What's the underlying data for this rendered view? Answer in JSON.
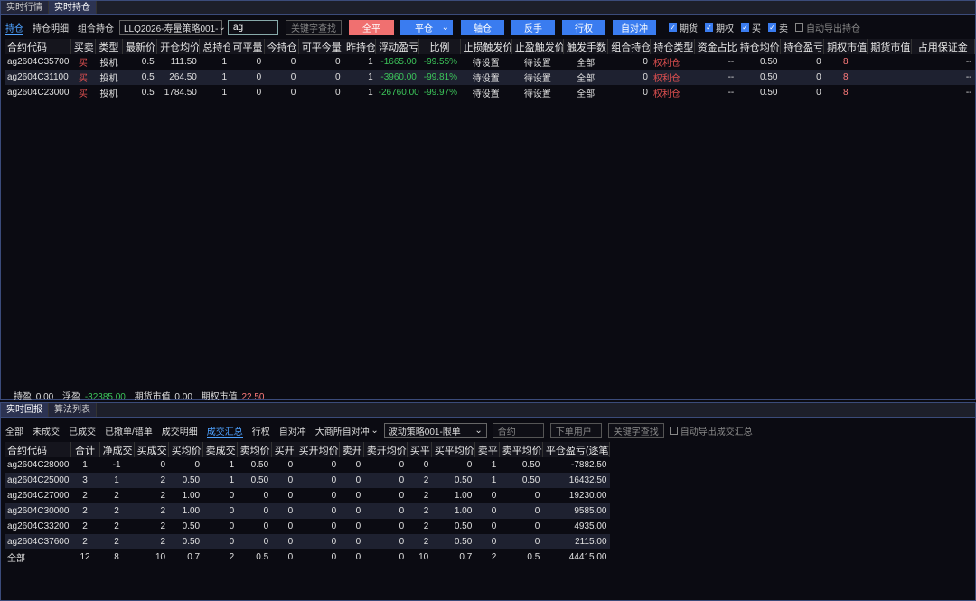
{
  "top": {
    "tabs": [
      "实时行情",
      "实时持仓"
    ],
    "subtabs": [
      "持仓",
      "持仓明细",
      "组合持仓"
    ],
    "strategy_select": "LLQ2026-寿量策略001-",
    "search_value": "ag",
    "keyword_placeholder": "关键字查找",
    "buttons": [
      "全平",
      "平仓",
      "轴仓",
      "反手",
      "行权",
      "自对冲"
    ],
    "checks": [
      {
        "label": "期货",
        "checked": true
      },
      {
        "label": "期权",
        "checked": true
      },
      {
        "label": "买",
        "checked": true
      },
      {
        "label": "卖",
        "checked": true
      },
      {
        "label": "自动导出持仓",
        "checked": false
      }
    ],
    "columns": [
      "合约代码",
      "买卖",
      "类型",
      "最新价",
      "开仓均价",
      "总持仓",
      "可平量",
      "今持仓",
      "可平今量",
      "昨持仓",
      "浮动盈亏",
      "比例",
      "止损触发价",
      "止盈触发价",
      "触发手数",
      "组合持仓",
      "持仓类型",
      "资金占比",
      "持仓均价",
      "持仓盈亏",
      "期权市值",
      "期货市值",
      "占用保证金"
    ],
    "rows": [
      [
        "ag2604C35700",
        "买",
        "投机",
        "0.5",
        "111.50",
        "1",
        "0",
        "0",
        "0",
        "1",
        "-1665.00",
        "-99.55%",
        "待设置",
        "待设置",
        "全部",
        "0",
        "权利仓",
        "--",
        "0.50",
        "0",
        "8",
        "",
        "--"
      ],
      [
        "ag2604C31100",
        "买",
        "投机",
        "0.5",
        "264.50",
        "1",
        "0",
        "0",
        "0",
        "1",
        "-3960.00",
        "-99.81%",
        "待设置",
        "待设置",
        "全部",
        "0",
        "权利仓",
        "--",
        "0.50",
        "0",
        "8",
        "",
        "--"
      ],
      [
        "ag2604C23000",
        "买",
        "投机",
        "0.5",
        "1784.50",
        "1",
        "0",
        "0",
        "0",
        "1",
        "-26760.00",
        "-99.97%",
        "待设置",
        "待设置",
        "全部",
        "0",
        "权利仓",
        "--",
        "0.50",
        "0",
        "8",
        "",
        "--"
      ]
    ],
    "summary": {
      "hold_profit_label": "持盈",
      "hold_profit": "0.00",
      "float_label": "浮盈",
      "float": "-32385.00",
      "fut_label": "期货市值",
      "fut": "0.00",
      "opt_label": "期权市值",
      "opt": "22.50"
    }
  },
  "bottom": {
    "tabs": [
      "实时回报",
      "算法列表"
    ],
    "subtabs": [
      "全部",
      "未成交",
      "已成交",
      "已撤单/错单",
      "成交明细",
      "成交汇总",
      "行权",
      "自对冲"
    ],
    "dealer_select": "大商所自对冲",
    "strategy_select": "波动策略001-限单",
    "contract_placeholder": "合约",
    "user_placeholder": "下单用户",
    "keyword_placeholder": "关键字查找",
    "auto_export": "自动导出成交汇总",
    "columns": [
      "合约代码",
      "合计",
      "净成交",
      "买成交",
      "买均价",
      "卖成交",
      "卖均价",
      "买开",
      "买开均价",
      "卖开",
      "卖开均价",
      "买平",
      "买平均价",
      "卖平",
      "卖平均价",
      "平仓盈亏(逐笔)"
    ],
    "rows": [
      [
        "ag2604C28000",
        "1",
        "-1",
        "0",
        "0",
        "1",
        "0.50",
        "0",
        "0",
        "0",
        "0",
        "0",
        "0",
        "1",
        "0.50",
        "-7882.50"
      ],
      [
        "ag2604C25000",
        "3",
        "1",
        "2",
        "0.50",
        "1",
        "0.50",
        "0",
        "0",
        "0",
        "0",
        "2",
        "0.50",
        "1",
        "0.50",
        "16432.50"
      ],
      [
        "ag2604C27000",
        "2",
        "2",
        "2",
        "1.00",
        "0",
        "0",
        "0",
        "0",
        "0",
        "0",
        "2",
        "1.00",
        "0",
        "0",
        "19230.00"
      ],
      [
        "ag2604C30000",
        "2",
        "2",
        "2",
        "1.00",
        "0",
        "0",
        "0",
        "0",
        "0",
        "0",
        "2",
        "1.00",
        "0",
        "0",
        "9585.00"
      ],
      [
        "ag2604C33200",
        "2",
        "2",
        "2",
        "0.50",
        "0",
        "0",
        "0",
        "0",
        "0",
        "0",
        "2",
        "0.50",
        "0",
        "0",
        "4935.00"
      ],
      [
        "ag2604C37600",
        "2",
        "2",
        "2",
        "0.50",
        "0",
        "0",
        "0",
        "0",
        "0",
        "0",
        "2",
        "0.50",
        "0",
        "0",
        "2115.00"
      ]
    ],
    "total": [
      "全部",
      "12",
      "8",
      "10",
      "0.7",
      "2",
      "0.5",
      "0",
      "0",
      "0",
      "0",
      "10",
      "0.7",
      "2",
      "0.5",
      "44415.00"
    ]
  }
}
